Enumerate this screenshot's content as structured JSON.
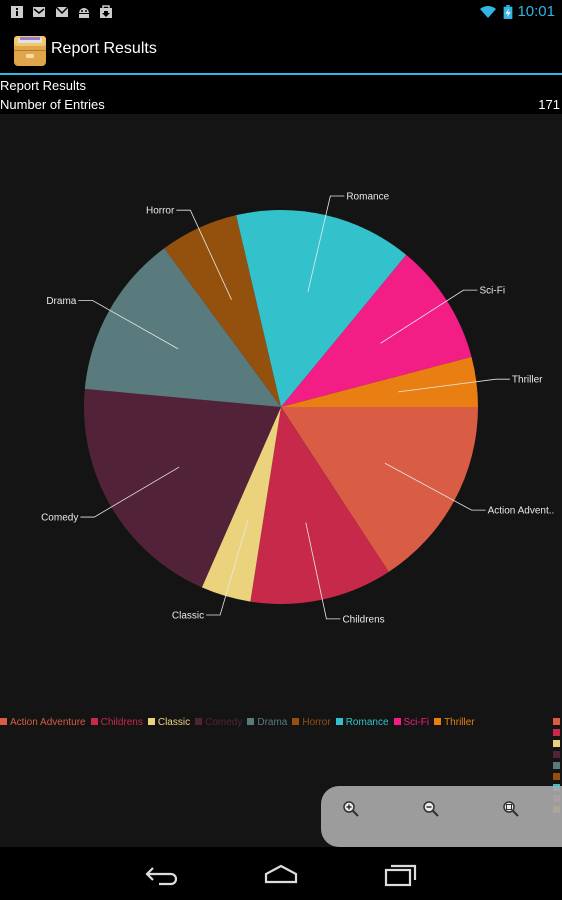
{
  "status_bar": {
    "time": "10:01",
    "time_color": "#33b5e5",
    "notification_icons": [
      "info-icon",
      "mail-icon",
      "gmail-icon",
      "android-icon",
      "download-icon"
    ],
    "system_icons": [
      "wifi-icon",
      "battery-charging-icon"
    ]
  },
  "action_bar": {
    "title": "Report Results",
    "app_icon": "file-cabinet-icon",
    "accent_color": "#33b5e5"
  },
  "report": {
    "title": "Report Results",
    "entries_label": "Number of Entries",
    "entries_value": "171"
  },
  "chart_data": {
    "type": "pie",
    "categories": [
      "Action Adventure",
      "Childrens",
      "Classic",
      "Comedy",
      "Drama",
      "Horror",
      "Romance",
      "Sci-Fi",
      "Thriller"
    ],
    "values": [
      27,
      20,
      7,
      34,
      23,
      11,
      25,
      17,
      7
    ],
    "colors": [
      "#d95c45",
      "#c7294a",
      "#ebd37e",
      "#522338",
      "#5a7b7e",
      "#94510e",
      "#33c2cc",
      "#f21d85",
      "#e97f12"
    ],
    "slice_labels": [
      "Action Advent..",
      "Childrens",
      "Classic",
      "Comedy",
      "Drama",
      "Horror",
      "Romance",
      "Sci-Fi",
      "Thriller"
    ],
    "legend_position": "bottom",
    "title": ""
  },
  "zoom_controls": {
    "icons": [
      "zoom-in-icon",
      "zoom-out-icon",
      "zoom-reset-icon"
    ]
  },
  "nav_bar": {
    "icons": [
      "back-icon",
      "home-icon",
      "recent-apps-icon"
    ]
  }
}
